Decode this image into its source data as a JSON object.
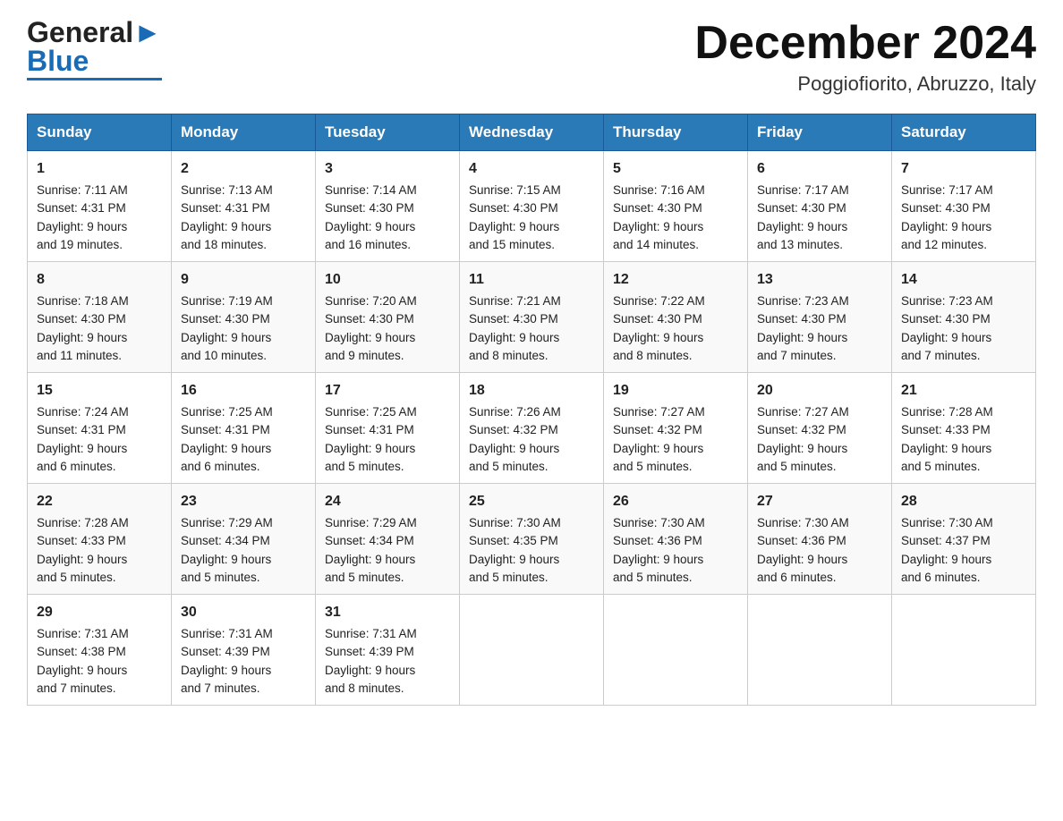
{
  "header": {
    "logo_general": "General",
    "logo_blue": "Blue",
    "title": "December 2024",
    "subtitle": "Poggiofiorito, Abruzzo, Italy"
  },
  "calendar": {
    "days_of_week": [
      "Sunday",
      "Monday",
      "Tuesday",
      "Wednesday",
      "Thursday",
      "Friday",
      "Saturday"
    ],
    "weeks": [
      [
        {
          "day": "1",
          "sunrise": "7:11 AM",
          "sunset": "4:31 PM",
          "daylight": "9 hours and 19 minutes."
        },
        {
          "day": "2",
          "sunrise": "7:13 AM",
          "sunset": "4:31 PM",
          "daylight": "9 hours and 18 minutes."
        },
        {
          "day": "3",
          "sunrise": "7:14 AM",
          "sunset": "4:30 PM",
          "daylight": "9 hours and 16 minutes."
        },
        {
          "day": "4",
          "sunrise": "7:15 AM",
          "sunset": "4:30 PM",
          "daylight": "9 hours and 15 minutes."
        },
        {
          "day": "5",
          "sunrise": "7:16 AM",
          "sunset": "4:30 PM",
          "daylight": "9 hours and 14 minutes."
        },
        {
          "day": "6",
          "sunrise": "7:17 AM",
          "sunset": "4:30 PM",
          "daylight": "9 hours and 13 minutes."
        },
        {
          "day": "7",
          "sunrise": "7:17 AM",
          "sunset": "4:30 PM",
          "daylight": "9 hours and 12 minutes."
        }
      ],
      [
        {
          "day": "8",
          "sunrise": "7:18 AM",
          "sunset": "4:30 PM",
          "daylight": "9 hours and 11 minutes."
        },
        {
          "day": "9",
          "sunrise": "7:19 AM",
          "sunset": "4:30 PM",
          "daylight": "9 hours and 10 minutes."
        },
        {
          "day": "10",
          "sunrise": "7:20 AM",
          "sunset": "4:30 PM",
          "daylight": "9 hours and 9 minutes."
        },
        {
          "day": "11",
          "sunrise": "7:21 AM",
          "sunset": "4:30 PM",
          "daylight": "9 hours and 8 minutes."
        },
        {
          "day": "12",
          "sunrise": "7:22 AM",
          "sunset": "4:30 PM",
          "daylight": "9 hours and 8 minutes."
        },
        {
          "day": "13",
          "sunrise": "7:23 AM",
          "sunset": "4:30 PM",
          "daylight": "9 hours and 7 minutes."
        },
        {
          "day": "14",
          "sunrise": "7:23 AM",
          "sunset": "4:30 PM",
          "daylight": "9 hours and 7 minutes."
        }
      ],
      [
        {
          "day": "15",
          "sunrise": "7:24 AM",
          "sunset": "4:31 PM",
          "daylight": "9 hours and 6 minutes."
        },
        {
          "day": "16",
          "sunrise": "7:25 AM",
          "sunset": "4:31 PM",
          "daylight": "9 hours and 6 minutes."
        },
        {
          "day": "17",
          "sunrise": "7:25 AM",
          "sunset": "4:31 PM",
          "daylight": "9 hours and 5 minutes."
        },
        {
          "day": "18",
          "sunrise": "7:26 AM",
          "sunset": "4:32 PM",
          "daylight": "9 hours and 5 minutes."
        },
        {
          "day": "19",
          "sunrise": "7:27 AM",
          "sunset": "4:32 PM",
          "daylight": "9 hours and 5 minutes."
        },
        {
          "day": "20",
          "sunrise": "7:27 AM",
          "sunset": "4:32 PM",
          "daylight": "9 hours and 5 minutes."
        },
        {
          "day": "21",
          "sunrise": "7:28 AM",
          "sunset": "4:33 PM",
          "daylight": "9 hours and 5 minutes."
        }
      ],
      [
        {
          "day": "22",
          "sunrise": "7:28 AM",
          "sunset": "4:33 PM",
          "daylight": "9 hours and 5 minutes."
        },
        {
          "day": "23",
          "sunrise": "7:29 AM",
          "sunset": "4:34 PM",
          "daylight": "9 hours and 5 minutes."
        },
        {
          "day": "24",
          "sunrise": "7:29 AM",
          "sunset": "4:34 PM",
          "daylight": "9 hours and 5 minutes."
        },
        {
          "day": "25",
          "sunrise": "7:30 AM",
          "sunset": "4:35 PM",
          "daylight": "9 hours and 5 minutes."
        },
        {
          "day": "26",
          "sunrise": "7:30 AM",
          "sunset": "4:36 PM",
          "daylight": "9 hours and 5 minutes."
        },
        {
          "day": "27",
          "sunrise": "7:30 AM",
          "sunset": "4:36 PM",
          "daylight": "9 hours and 6 minutes."
        },
        {
          "day": "28",
          "sunrise": "7:30 AM",
          "sunset": "4:37 PM",
          "daylight": "9 hours and 6 minutes."
        }
      ],
      [
        {
          "day": "29",
          "sunrise": "7:31 AM",
          "sunset": "4:38 PM",
          "daylight": "9 hours and 7 minutes."
        },
        {
          "day": "30",
          "sunrise": "7:31 AM",
          "sunset": "4:39 PM",
          "daylight": "9 hours and 7 minutes."
        },
        {
          "day": "31",
          "sunrise": "7:31 AM",
          "sunset": "4:39 PM",
          "daylight": "9 hours and 8 minutes."
        },
        null,
        null,
        null,
        null
      ]
    ],
    "sunrise_label": "Sunrise:",
    "sunset_label": "Sunset:",
    "daylight_label": "Daylight:"
  }
}
